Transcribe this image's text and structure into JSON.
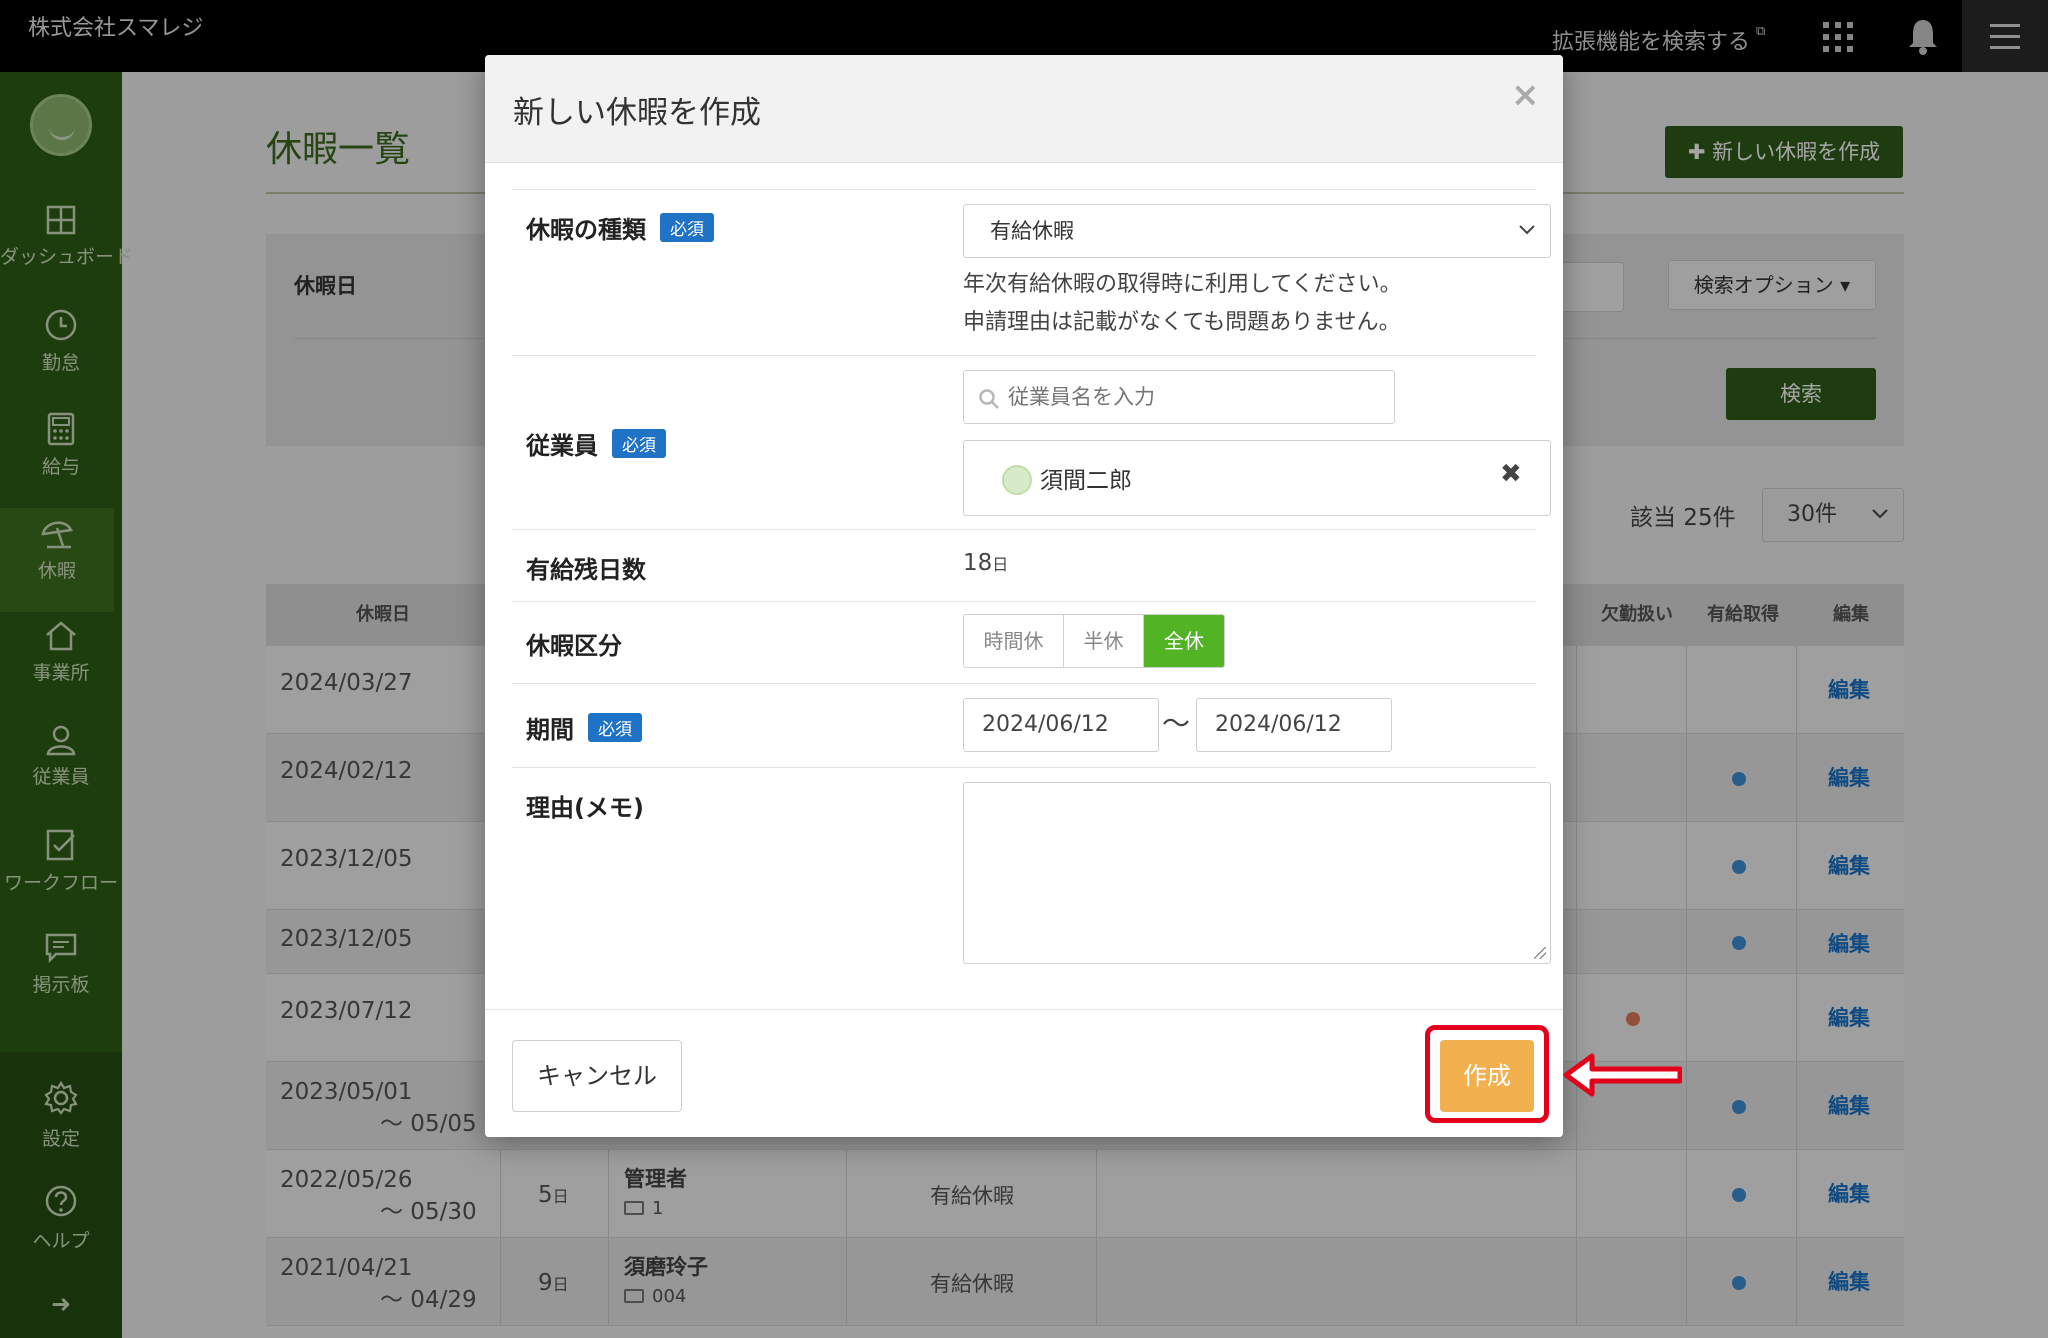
{
  "topbar": {
    "company": "株式会社スマレジ",
    "ext_link": "拡張機能を検索する",
    "ext_icon": "external-link-icon"
  },
  "sidebar": {
    "items": [
      {
        "label": "ダッシュボード",
        "icon": "dashboard-icon"
      },
      {
        "label": "勤怠",
        "icon": "clock-icon"
      },
      {
        "label": "給与",
        "icon": "calculator-icon"
      },
      {
        "label": "休暇",
        "icon": "umbrella-icon",
        "active": true
      },
      {
        "label": "事業所",
        "icon": "home-icon"
      },
      {
        "label": "従業員",
        "icon": "person-icon"
      },
      {
        "label": "ワークフロー",
        "icon": "checklist-icon"
      },
      {
        "label": "掲示板",
        "icon": "chat-icon"
      }
    ],
    "bottom": [
      {
        "label": "設定",
        "icon": "gear-icon"
      },
      {
        "label": "ヘルプ",
        "icon": "help-icon"
      }
    ]
  },
  "main": {
    "title": "休暇一覧",
    "new_button": "新しい休暇を作成",
    "filter": {
      "label": "休暇日",
      "search_options": "検索オプション",
      "search_button": "検索"
    },
    "hit_count": "該当 25件",
    "per_page": "30件",
    "table": {
      "headers": {
        "date": "休暇日",
        "absence": "欠勤扱い",
        "paid": "有給取得",
        "edit": "編集"
      },
      "edit_label": "編集",
      "rows": [
        {
          "date": "2024/03/27"
        },
        {
          "date": "2024/02/12"
        },
        {
          "date": "2023/12/05"
        },
        {
          "date": "2023/12/05"
        },
        {
          "date": "2023/07/12"
        },
        {
          "date": "2023/05/01",
          "end": "～ 05/05"
        },
        {
          "date": "2022/05/26",
          "end": "～ 05/30",
          "days": "5",
          "unit": "日",
          "employee": "管理者",
          "code": "1",
          "type": "有給休暇"
        },
        {
          "date": "2021/04/21",
          "end": "～ 04/29",
          "days": "9",
          "unit": "日",
          "employee": "須磨玲子",
          "code": "004",
          "type": "有給休暇"
        }
      ]
    }
  },
  "modal": {
    "title": "新しい休暇を作成",
    "close": "×",
    "required": "必須",
    "leave_type": {
      "label": "休暇の種類",
      "value": "有給休暇",
      "help1": "年次有給休暇の取得時に利用してください。",
      "help2": "申請理由は記載がなくても問題ありません。"
    },
    "employee": {
      "label": "従業員",
      "placeholder": "従業員名を入力",
      "selected": "須間二郎",
      "remove": "✖"
    },
    "remaining": {
      "label": "有給残日数",
      "value": "18",
      "unit": "日"
    },
    "division": {
      "label": "休暇区分",
      "options": [
        "時間休",
        "半休",
        "全休"
      ],
      "selected": "全休"
    },
    "period": {
      "label": "期間",
      "from": "2024/06/12",
      "sep": "〜",
      "to": "2024/06/12"
    },
    "memo": {
      "label": "理由(メモ)",
      "value": ""
    },
    "cancel": "キャンセル",
    "create": "作成"
  },
  "colors": {
    "brand_green": "#2f5c18",
    "accent_green": "#52b325",
    "create_orange": "#f2b04f",
    "required_blue": "#1f73c6",
    "annotation_red": "#e3001b"
  }
}
